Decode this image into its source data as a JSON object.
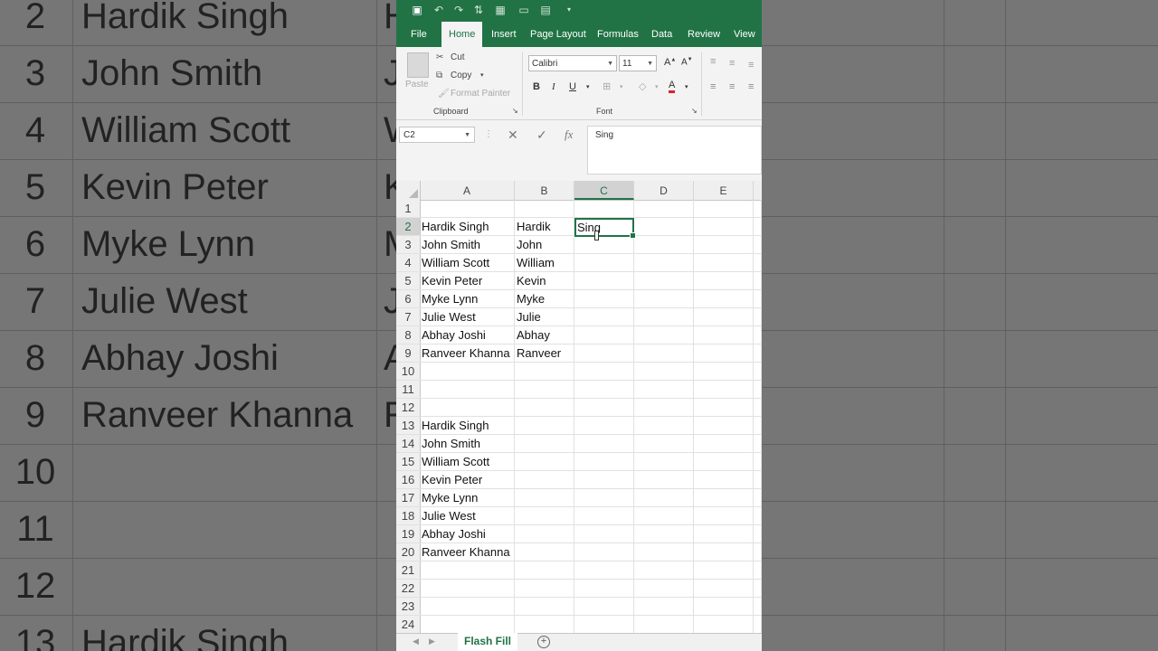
{
  "background": {
    "rows": [
      {
        "num": "2",
        "name": "Hardik Singh",
        "b": "H"
      },
      {
        "num": "3",
        "name": "John Smith",
        "b": "J"
      },
      {
        "num": "4",
        "name": "William Scott",
        "b": "W"
      },
      {
        "num": "5",
        "name": "Kevin Peter",
        "b": "K"
      },
      {
        "num": "6",
        "name": "Myke Lynn",
        "b": "M"
      },
      {
        "num": "7",
        "name": "Julie West",
        "b": "J"
      },
      {
        "num": "8",
        "name": "Abhay Joshi",
        "b": "A"
      },
      {
        "num": "9",
        "name": "Ranveer Khanna",
        "b": "R"
      },
      {
        "num": "10",
        "name": "",
        "b": ""
      },
      {
        "num": "11",
        "name": "",
        "b": ""
      },
      {
        "num": "12",
        "name": "",
        "b": ""
      },
      {
        "num": "13",
        "name": "Hardik Singh",
        "b": ""
      }
    ]
  },
  "tabs": [
    "File",
    "Home",
    "Insert",
    "Page Layout",
    "Formulas",
    "Data",
    "Review",
    "View"
  ],
  "active_tab": "Home",
  "ribbon": {
    "clipboard": {
      "paste": "Paste",
      "cut": "Cut",
      "copy": "Copy",
      "format_painter": "Format Painter",
      "group_label": "Clipboard"
    },
    "font": {
      "family": "Calibri",
      "size": "11",
      "group_label": "Font"
    }
  },
  "formula_bar": {
    "name_box": "C2",
    "content": "Sing",
    "fx": "fx"
  },
  "columns": [
    "A",
    "B",
    "C",
    "D",
    "E"
  ],
  "selected_column": "C",
  "selected_row": "2",
  "rows": [
    {
      "n": "1",
      "a": "",
      "b": ""
    },
    {
      "n": "2",
      "a": "Hardik Singh",
      "b": "Hardik"
    },
    {
      "n": "3",
      "a": "John Smith",
      "b": "John"
    },
    {
      "n": "4",
      "a": "William Scott",
      "b": "William"
    },
    {
      "n": "5",
      "a": "Kevin Peter",
      "b": "Kevin"
    },
    {
      "n": "6",
      "a": "Myke Lynn",
      "b": "Myke"
    },
    {
      "n": "7",
      "a": "Julie West",
      "b": "Julie"
    },
    {
      "n": "8",
      "a": "Abhay Joshi",
      "b": "Abhay"
    },
    {
      "n": "9",
      "a": "Ranveer Khanna",
      "b": "Ranveer"
    },
    {
      "n": "10",
      "a": "",
      "b": ""
    },
    {
      "n": "11",
      "a": "",
      "b": ""
    },
    {
      "n": "12",
      "a": "",
      "b": ""
    },
    {
      "n": "13",
      "a": "Hardik Singh",
      "b": ""
    },
    {
      "n": "14",
      "a": "John Smith",
      "b": ""
    },
    {
      "n": "15",
      "a": "William Scott",
      "b": ""
    },
    {
      "n": "16",
      "a": "Kevin Peter",
      "b": ""
    },
    {
      "n": "17",
      "a": "Myke Lynn",
      "b": ""
    },
    {
      "n": "18",
      "a": "Julie West",
      "b": ""
    },
    {
      "n": "19",
      "a": "Abhay Joshi",
      "b": ""
    },
    {
      "n": "20",
      "a": "Ranveer Khanna",
      "b": ""
    },
    {
      "n": "21",
      "a": "",
      "b": ""
    },
    {
      "n": "22",
      "a": "",
      "b": ""
    },
    {
      "n": "23",
      "a": "",
      "b": ""
    },
    {
      "n": "24",
      "a": "",
      "b": ""
    }
  ],
  "active_cell_text": "Sing",
  "sheet_tab": "Flash Fill",
  "colors": {
    "excel_green": "#217346"
  }
}
